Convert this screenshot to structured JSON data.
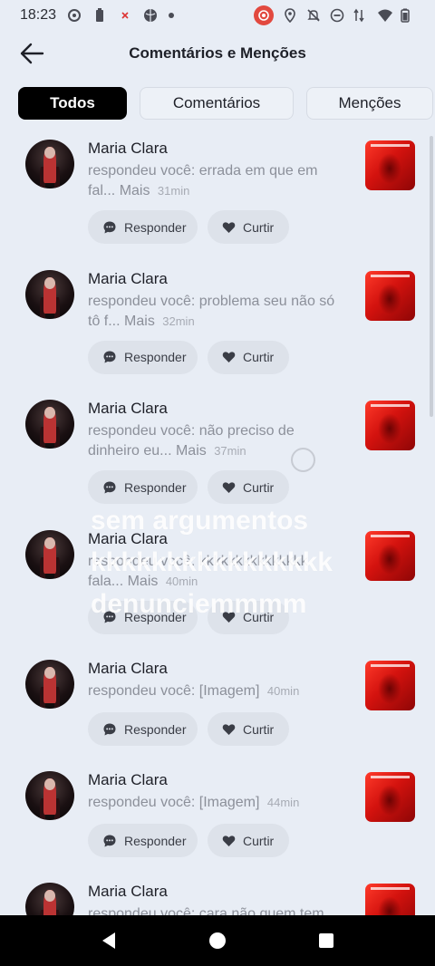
{
  "status_bar": {
    "time": "18:23"
  },
  "header": {
    "title": "Comentários e Menções"
  },
  "tabs": [
    {
      "label": "Todos",
      "active": true
    },
    {
      "label": "Comentários",
      "active": false
    },
    {
      "label": "Menções",
      "active": false
    }
  ],
  "items": [
    {
      "user": "Maria Clara",
      "text": "respondeu você: errada em que em fal...",
      "more": "Mais",
      "time": "31min"
    },
    {
      "user": "Maria Clara",
      "text": "respondeu você: problema seu não só tô f...",
      "more": "Mais",
      "time": "32min"
    },
    {
      "user": "Maria Clara",
      "text": "respondeu você: não preciso de dinheiro  eu...",
      "more": "Mais",
      "time": "37min"
    },
    {
      "user": "Maria Clara",
      "text": "respondeu você: kkkkkkkkkkkkkkk fala...",
      "more": "Mais",
      "time": "40min"
    },
    {
      "user": "Maria Clara",
      "text": "respondeu você: [Imagem]",
      "more": "",
      "time": "40min"
    },
    {
      "user": "Maria Clara",
      "text": "respondeu você: [Imagem]",
      "more": "",
      "time": "44min"
    },
    {
      "user": "Maria Clara",
      "text": "respondeu você: cara não quem tem...",
      "more": "",
      "time": ""
    }
  ],
  "actions": {
    "reply": "Responder",
    "like": "Curtir"
  },
  "overlay_caption": {
    "line1": "sem argumentos",
    "line2": "kkkkkkkkkkkkkkkk",
    "line3": "denunciemmmm"
  },
  "colors": {
    "background": "#e8edf5",
    "active_tab": "#000000",
    "muted_text": "#8c909a",
    "record_badge": "#e2493f"
  }
}
